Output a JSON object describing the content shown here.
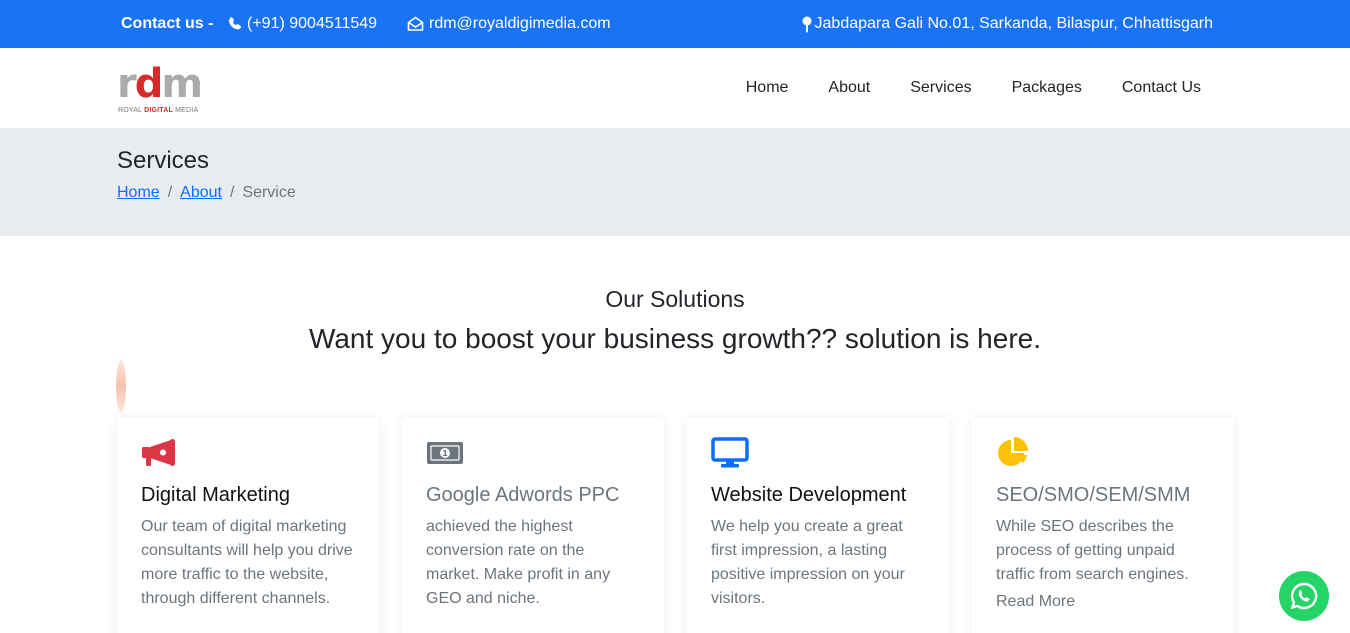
{
  "topbar": {
    "contact_label": "Contact us -",
    "phone": "(+91) 9004511549",
    "email": "rdm@royaldigimedia.com",
    "address": "Jabdapara Gali No.01, Sarkanda, Bilaspur, Chhattisgarh"
  },
  "logo": {
    "letters": [
      "r",
      "d",
      "m"
    ],
    "tagline_left": "ROYAL ",
    "tagline_mid": "DIGITAL",
    "tagline_right": " MEDIA"
  },
  "nav": {
    "items": [
      "Home",
      "About",
      "Services",
      "Packages",
      "Contact Us"
    ]
  },
  "page_header": {
    "title": "Services",
    "breadcrumb": [
      "Home",
      "About",
      "Service"
    ],
    "separator": "/"
  },
  "solutions": {
    "title": "Our Solutions",
    "subtitle": "Want you to boost your business growth?? solution is here."
  },
  "cards": [
    {
      "icon": "megaphone-icon",
      "icon_color": "#dc3545",
      "title": "Digital Marketing",
      "text": "Our team of digital marketing consultants will help you drive more traffic to the website, through different channels."
    },
    {
      "icon": "money-icon",
      "icon_color": "#6c757d",
      "title": "Google Adwords PPC",
      "text": "achieved the highest conversion rate on the market. Make profit in any GEO and niche."
    },
    {
      "icon": "monitor-icon",
      "icon_color": "#0d6efd",
      "title": "Website Development",
      "text": "We help you create a great first impression, a lasting positive impression on your visitors."
    },
    {
      "icon": "pie-chart-icon",
      "icon_color": "#ffc107",
      "title": "SEO/SMO/SEM/SMM",
      "text": "While SEO describes the process of getting unpaid traffic from search engines.",
      "link": "Read More"
    }
  ],
  "colors": {
    "topbar": "#1a73f5",
    "header_bg": "#e9ecef",
    "whatsapp": "#25d366"
  }
}
